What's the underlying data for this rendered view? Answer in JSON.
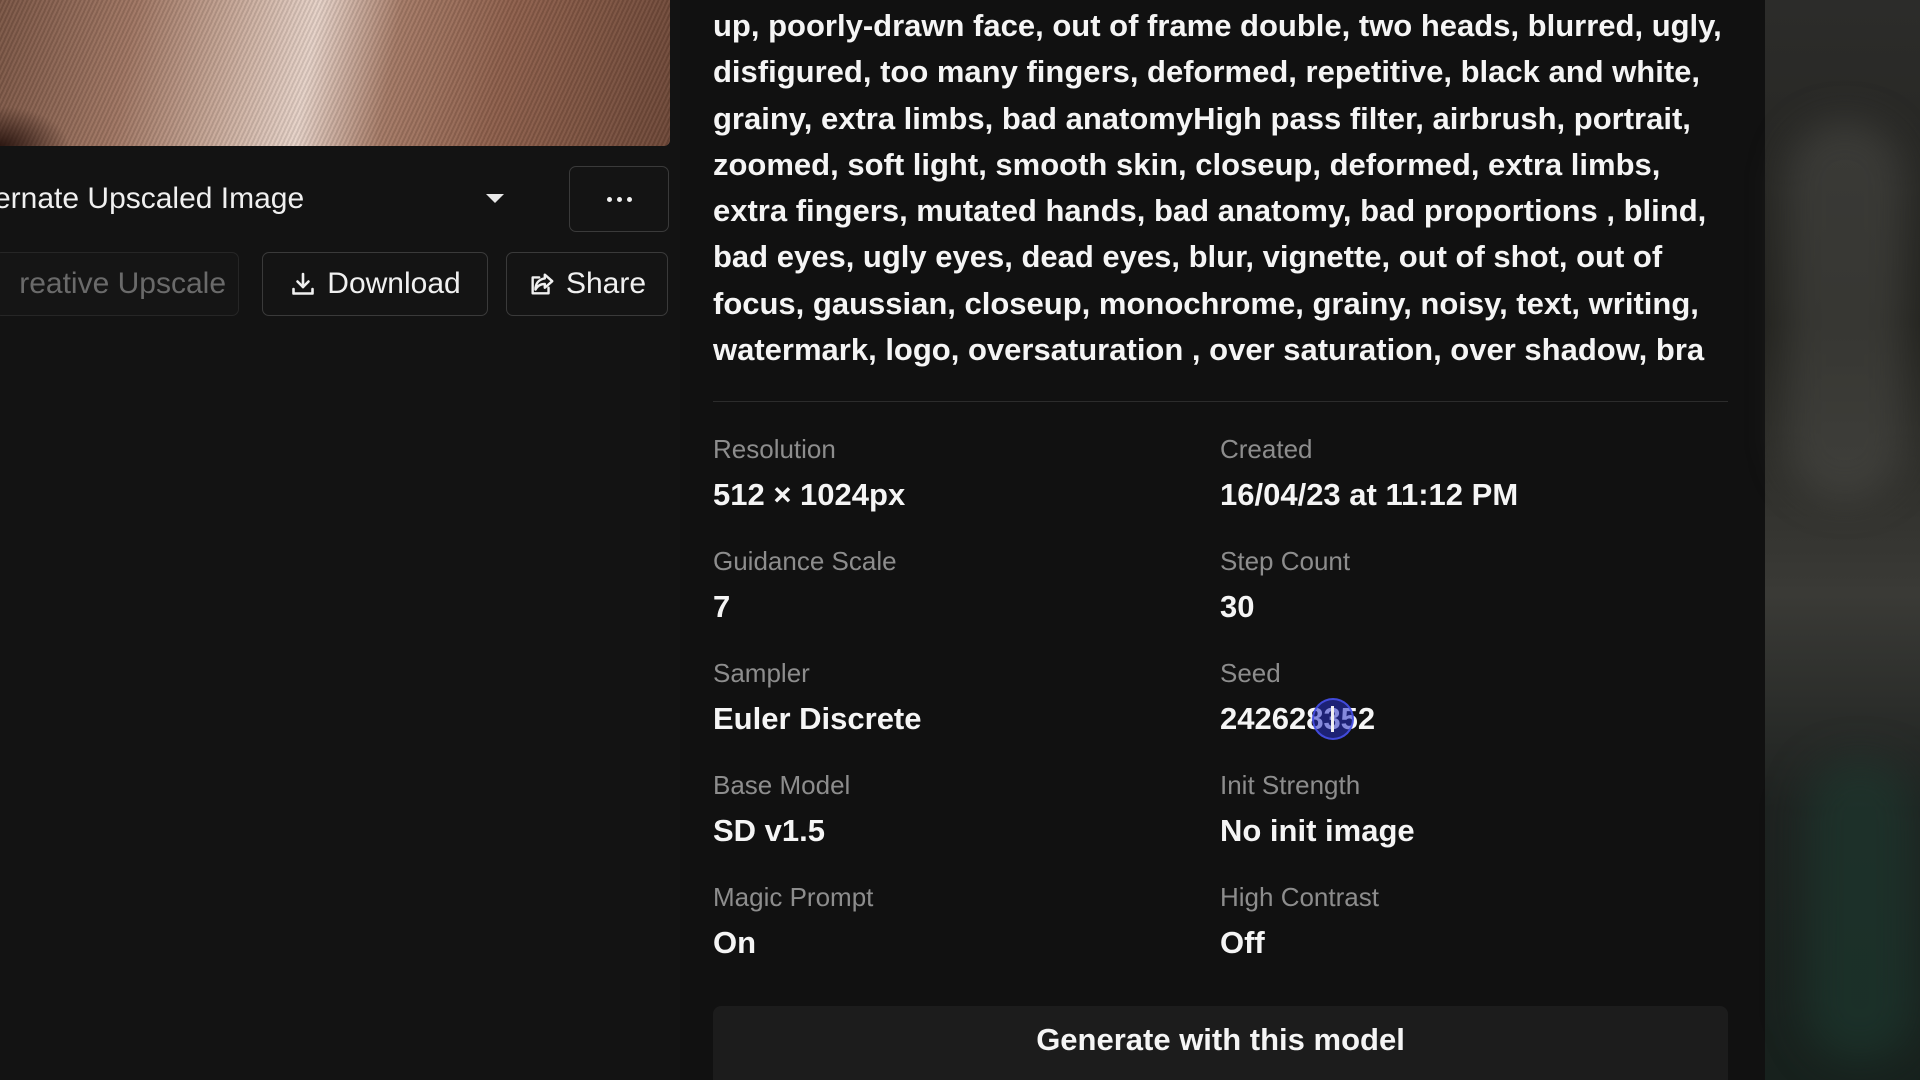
{
  "image_actions": {
    "variant_select_value": "ernate Upscaled Image",
    "creative_upscale_label": "reative Upscale",
    "download_label": "Download",
    "share_label": "Share"
  },
  "prompt": {
    "negative_text": "up, poorly-drawn face, out of frame double, two heads, blurred, ugly, disfigured, too many fingers, deformed, repetitive, black and white, grainy, extra limbs, bad anatomyHigh pass filter, airbrush, portrait, zoomed, soft light, smooth skin, closeup, deformed, extra limbs, extra fingers, mutated hands, bad anatomy, bad proportions , blind, bad eyes, ugly eyes, dead eyes, blur, vignette, out of shot, out of focus, gaussian, closeup, monochrome, grainy, noisy, text, writing, watermark, logo, oversaturation , over saturation, over shadow, bra"
  },
  "details": {
    "resolution": {
      "label": "Resolution",
      "value": "512 × 1024px"
    },
    "created": {
      "label": "Created",
      "value": "16/04/23 at 11:12 PM"
    },
    "guidance_scale": {
      "label": "Guidance Scale",
      "value": "7"
    },
    "step_count": {
      "label": "Step Count",
      "value": "30"
    },
    "sampler": {
      "label": "Sampler",
      "value": "Euler Discrete"
    },
    "seed": {
      "label": "Seed",
      "value": "242628352"
    },
    "base_model": {
      "label": "Base Model",
      "value": "SD v1.5"
    },
    "init_strength": {
      "label": "Init Strength",
      "value": "No init image"
    },
    "magic_prompt": {
      "label": "Magic Prompt",
      "value": "On"
    },
    "high_contrast": {
      "label": "High Contrast",
      "value": "Off"
    }
  },
  "generate_button_label": "Generate with this model",
  "icons": {
    "more": "more-horizontal-icon",
    "variant_caret": "chevron-down-icon",
    "download": "download-icon",
    "share": "share-icon"
  }
}
